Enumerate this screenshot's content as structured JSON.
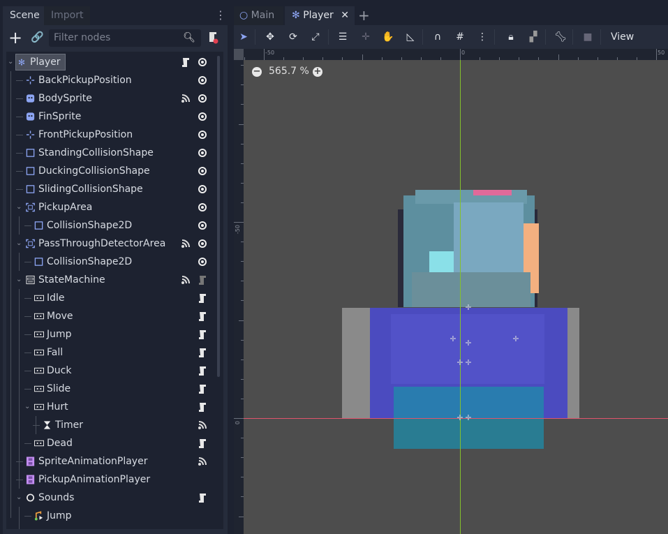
{
  "left_panel": {
    "tabs": [
      "Scene",
      "Import"
    ],
    "filter_placeholder": "Filter nodes"
  },
  "tree": [
    {
      "label": "Player",
      "icon": "character-body-icon",
      "level": 0,
      "expanded": true,
      "selected": true,
      "script": true,
      "eye": true
    },
    {
      "label": "BackPickupPosition",
      "icon": "marker2d-icon",
      "level": 1,
      "eye": true
    },
    {
      "label": "BodySprite",
      "icon": "sprite-icon",
      "level": 1,
      "signal": true,
      "eye": true
    },
    {
      "label": "FinSprite",
      "icon": "sprite-icon",
      "level": 1,
      "eye": true
    },
    {
      "label": "FrontPickupPosition",
      "icon": "marker2d-icon",
      "level": 1,
      "eye": true
    },
    {
      "label": "StandingCollisionShape",
      "icon": "collision-shape-icon",
      "level": 1,
      "eye": true
    },
    {
      "label": "DuckingCollisionShape",
      "icon": "collision-shape-icon",
      "level": 1,
      "eye": true
    },
    {
      "label": "SlidingCollisionShape",
      "icon": "collision-shape-icon",
      "level": 1,
      "eye": true
    },
    {
      "label": "PickupArea",
      "icon": "area2d-icon",
      "level": 1,
      "expanded": true,
      "eye": true
    },
    {
      "label": "CollisionShape2D",
      "icon": "collision-shape-icon",
      "level": 2,
      "eye": true
    },
    {
      "label": "PassThroughDetectorArea",
      "icon": "area2d-icon",
      "level": 1,
      "expanded": true,
      "signal": true,
      "eye": true
    },
    {
      "label": "CollisionShape2D",
      "icon": "collision-shape-icon",
      "level": 2,
      "eye": true
    },
    {
      "label": "StateMachine",
      "icon": "state-machine-icon",
      "level": 1,
      "expanded": true,
      "signal": true,
      "script": true,
      "script_dim": true
    },
    {
      "label": "Idle",
      "icon": "node-state-icon",
      "level": 2,
      "script": true
    },
    {
      "label": "Move",
      "icon": "node-state-icon",
      "level": 2,
      "script": true
    },
    {
      "label": "Jump",
      "icon": "node-state-icon",
      "level": 2,
      "script": true
    },
    {
      "label": "Fall",
      "icon": "node-state-icon",
      "level": 2,
      "script": true
    },
    {
      "label": "Duck",
      "icon": "node-state-icon",
      "level": 2,
      "script": true
    },
    {
      "label": "Slide",
      "icon": "node-state-icon",
      "level": 2,
      "script": true
    },
    {
      "label": "Hurt",
      "icon": "node-state-icon",
      "level": 2,
      "expanded": true,
      "script": true
    },
    {
      "label": "Timer",
      "icon": "timer-icon",
      "level": 3,
      "signal": true
    },
    {
      "label": "Dead",
      "icon": "node-state-icon",
      "level": 2,
      "script": true
    },
    {
      "label": "SpriteAnimationPlayer",
      "icon": "animation-player-icon",
      "level": 1,
      "signal": true
    },
    {
      "label": "PickupAnimationPlayer",
      "icon": "animation-player-icon",
      "level": 1
    },
    {
      "label": "Sounds",
      "icon": "node-circle-icon",
      "level": 1,
      "expanded": true,
      "script": true
    },
    {
      "label": "Jump",
      "icon": "audio-player-icon",
      "level": 2
    }
  ],
  "editor": {
    "tabs": [
      "Main",
      "Player"
    ],
    "view_menu": "View",
    "zoom": "565.7 %",
    "ruler_top": [
      "-50",
      "0",
      "50"
    ],
    "ruler_left": [
      "-50",
      "0"
    ]
  },
  "colors": {
    "accent": "#8da5f3",
    "x_axis": "#e0546c",
    "y_axis": "#84c12c",
    "canvas": "#4d4d4d"
  }
}
